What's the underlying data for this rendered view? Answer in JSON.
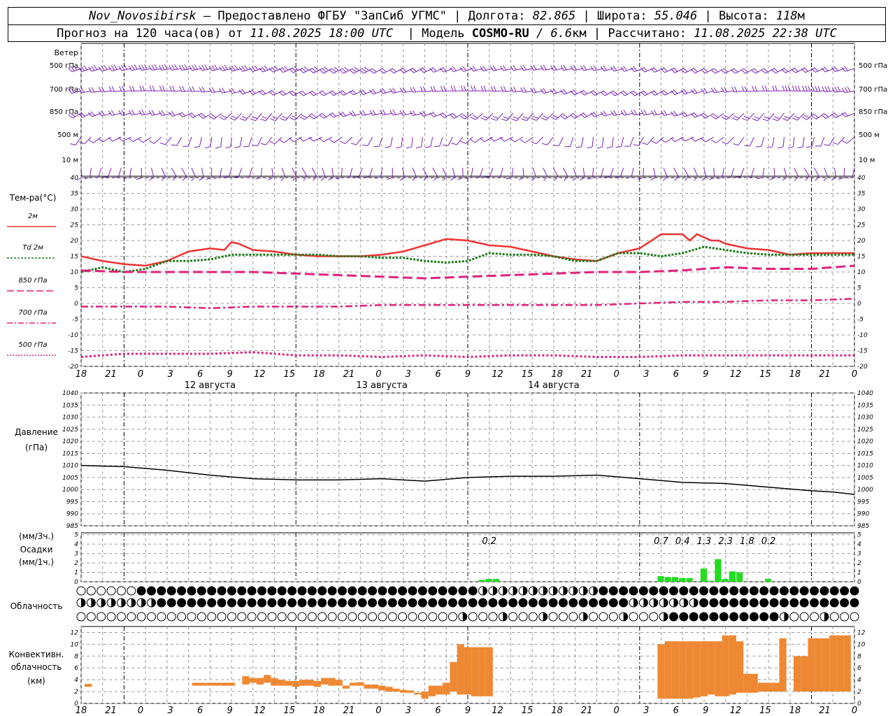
{
  "header": {
    "station": "Nov_Novosibirsk",
    "provider": "– Предоставлено ФГБУ \"ЗапСиб УГМС\"",
    "lon_label": "Долгота:",
    "lon_value": "82.865",
    "lat_label": "Широта:",
    "lat_value": "55.046",
    "alt_label": "Высота:",
    "alt_value": "118",
    "alt_unit": "м",
    "forecast_label": "Прогноз на 120 часа(ов) от",
    "forecast_from": "11.08.2025 18:00 UTC",
    "model_label": "Модель",
    "model_name": "COSMO-RU",
    "model_res_value": "/ 6.6",
    "model_res_unit": "км",
    "calc_label": "Рассчитано:",
    "calc_time": "11.08.2025 22:38 UTC"
  },
  "colors": {
    "temp2m": "#ee3333",
    "td2m": "#1a7a1a",
    "t850": "#e0207a",
    "t700": "#e0207a",
    "t500": "#e0207a",
    "wind": "#7a22b8",
    "pressure": "#000000",
    "precip": "#22dd22",
    "convective": "#ee8833",
    "grid": "#999999"
  },
  "time_axis": {
    "ticks": [
      "18",
      "21",
      "0",
      "3",
      "6",
      "9",
      "12",
      "15",
      "18",
      "21",
      "0",
      "3",
      "6",
      "9",
      "12",
      "15",
      "18",
      "21",
      "0",
      "3",
      "6",
      "9",
      "12",
      "15",
      "18",
      "21",
      "0"
    ],
    "days": [
      "12 августа",
      "13 августа",
      "14 августа"
    ]
  },
  "wind_panel": {
    "title": "Ветер",
    "levels": [
      "500 гПа",
      "700 гПа",
      "850 гПа",
      "500 м",
      "10 м"
    ]
  },
  "temp_panel": {
    "title": "Тем-ра(°C)",
    "legend": [
      {
        "label": "2м",
        "style": "solid"
      },
      {
        "label": "Td  2м",
        "style": "dotted"
      },
      {
        "label": "850 гПа",
        "style": "dash"
      },
      {
        "label": "700 гПа",
        "style": "dashdot"
      },
      {
        "label": "500 гПа",
        "style": "dot"
      }
    ],
    "ticks": [
      "40",
      "35",
      "30",
      "25",
      "20",
      "15",
      "10",
      "5",
      "0",
      "-5",
      "-10",
      "-15",
      "-20"
    ]
  },
  "pressure_panel": {
    "title": "Давление",
    "unit": "(гПа)",
    "ticks": [
      "1040",
      "1035",
      "1030",
      "1025",
      "1020",
      "1015",
      "1010",
      "1005",
      "1000",
      "995",
      "990",
      "985"
    ]
  },
  "precip_panel": {
    "unit3": "(мм/3ч.)",
    "title": "Осадки",
    "unit1": "(мм/1ч.)",
    "ticks": [
      "5",
      "4",
      "3",
      "2",
      "1",
      "0"
    ],
    "totals": [
      {
        "hour": 57,
        "text": "0.2"
      },
      {
        "hour": 81,
        "text": "0.7"
      },
      {
        "hour": 84,
        "text": "0.4"
      },
      {
        "hour": 87,
        "text": "1.3"
      },
      {
        "hour": 90,
        "text": "2.3"
      },
      {
        "hour": 93,
        "text": "1.8"
      },
      {
        "hour": 96,
        "text": "0.2"
      }
    ]
  },
  "cloud_panel": {
    "title": "Облачность"
  },
  "conv_panel": {
    "title1": "Конвективн.",
    "title2": "облачность",
    "unit": "(км)",
    "ticks": [
      "12",
      "10",
      "8",
      "6",
      "4",
      "2",
      "0"
    ]
  },
  "chart_data": [
    {
      "type": "line",
      "title": "Тем-ра(°C)",
      "x_unit": "hours since 11.08.2025 18:00 UTC",
      "ylim": [
        -20,
        40
      ],
      "series": [
        {
          "name": "2м",
          "x": [
            0,
            3,
            6,
            9,
            12,
            15,
            18,
            20,
            21,
            22,
            24,
            27,
            30,
            33,
            36,
            39,
            42,
            45,
            48,
            51,
            54,
            57,
            60,
            63,
            66,
            69,
            72,
            75,
            78,
            81,
            84,
            85,
            86,
            87,
            88,
            89,
            90,
            93,
            96,
            99,
            102,
            105,
            108
          ],
          "values": [
            15,
            13.5,
            12.5,
            12,
            13.5,
            16.5,
            17.5,
            17,
            19.5,
            19,
            17,
            16.5,
            15.5,
            15,
            15,
            15,
            15.5,
            16.5,
            18.5,
            20.5,
            20,
            18.5,
            18,
            16.5,
            15,
            14,
            13.5,
            16,
            17.5,
            22,
            22,
            20,
            22,
            21,
            20,
            20,
            19,
            17.5,
            17,
            15.5,
            16,
            16,
            16
          ]
        },
        {
          "name": "Td  2м",
          "x": [
            0,
            3,
            6,
            9,
            12,
            15,
            18,
            21,
            24,
            27,
            30,
            33,
            36,
            39,
            42,
            45,
            48,
            51,
            54,
            57,
            60,
            63,
            66,
            69,
            72,
            75,
            78,
            81,
            84,
            87,
            90,
            93,
            96,
            99,
            102,
            105,
            108
          ],
          "values": [
            10,
            11.5,
            10,
            11,
            13.5,
            13.5,
            14,
            15.5,
            15.5,
            15.5,
            15.5,
            15.5,
            15,
            15,
            14.5,
            14.5,
            13.5,
            13,
            13.5,
            16,
            15.5,
            15.5,
            15,
            13.5,
            13.5,
            16,
            16,
            15,
            16,
            18,
            17,
            16,
            15.5,
            15.5,
            15.5,
            15.5,
            15.5
          ]
        },
        {
          "name": "850 гПа",
          "x": [
            0,
            6,
            12,
            18,
            24,
            30,
            36,
            42,
            48,
            54,
            60,
            66,
            72,
            78,
            84,
            90,
            96,
            102,
            108
          ],
          "values": [
            10.5,
            10,
            10,
            10,
            10,
            9.5,
            9,
            8.5,
            8,
            8.5,
            9,
            9.5,
            10,
            10,
            10.5,
            11.5,
            11,
            11,
            12
          ]
        },
        {
          "name": "700 гПа",
          "x": [
            0,
            6,
            12,
            18,
            24,
            30,
            36,
            42,
            48,
            54,
            60,
            66,
            72,
            78,
            84,
            90,
            96,
            102,
            108
          ],
          "values": [
            -1,
            -1,
            -1,
            -1.5,
            -1,
            -1,
            -1,
            -0.5,
            -0.5,
            -0.5,
            -0.5,
            -0.5,
            -0.5,
            0,
            0.5,
            0.5,
            1,
            1,
            1.5
          ]
        },
        {
          "name": "500 гПа",
          "x": [
            0,
            6,
            12,
            18,
            24,
            30,
            36,
            42,
            48,
            54,
            60,
            66,
            72,
            78,
            84,
            90,
            96,
            102,
            108
          ],
          "values": [
            -17,
            -16,
            -16,
            -16,
            -15.5,
            -16.5,
            -16.5,
            -17,
            -16.5,
            -17,
            -16.5,
            -16.5,
            -17,
            -17,
            -16.5,
            -16.5,
            -16.5,
            -16.5,
            -16.5
          ]
        }
      ]
    },
    {
      "type": "line",
      "title": "Давление",
      "x_unit": "hours since 11.08.2025 18:00 UTC",
      "ylim": [
        985,
        1040
      ],
      "series": [
        {
          "name": "Давление",
          "x": [
            0,
            6,
            12,
            18,
            24,
            30,
            36,
            42,
            48,
            54,
            60,
            66,
            72,
            78,
            84,
            90,
            96,
            102,
            105,
            108
          ],
          "values": [
            1010,
            1009.5,
            1008,
            1006,
            1004.5,
            1004,
            1004,
            1004.5,
            1003.5,
            1005,
            1005.5,
            1005.5,
            1006,
            1004.5,
            1003,
            1002.5,
            1001,
            999.5,
            999,
            998
          ]
        }
      ]
    },
    {
      "type": "bar",
      "title": "Осадки",
      "x_unit": "hours since 11.08.2025 18:00 UTC",
      "ylim": [
        0,
        5
      ],
      "series": [
        {
          "name": "Осадки",
          "x": [
            56,
            57,
            58,
            81,
            82,
            83,
            84,
            85,
            87,
            88,
            89,
            90,
            91,
            92,
            96
          ],
          "values": [
            0.2,
            0.3,
            0.3,
            0.6,
            0.5,
            0.5,
            0.4,
            0.4,
            1.4,
            0.1,
            2.4,
            0.3,
            1.1,
            1.0,
            0.3
          ]
        }
      ]
    },
    {
      "type": "bar",
      "title": "Конвективн. облачность",
      "x_unit": "hours since 11.08.2025 18:00 UTC",
      "ylim": [
        0,
        13
      ],
      "series": [
        {
          "name": "Конвективн. облачность",
          "x": [
            1,
            16,
            17,
            18,
            19,
            20,
            21,
            23,
            24,
            25,
            26,
            27,
            28,
            29,
            30,
            31,
            32,
            33,
            34,
            35,
            36,
            37,
            38,
            39,
            40,
            41,
            42,
            43,
            44,
            45,
            46,
            47,
            48,
            49,
            50,
            51,
            52,
            53,
            54,
            55,
            56,
            57,
            81,
            82,
            83,
            84,
            85,
            86,
            87,
            88,
            89,
            90,
            91,
            92,
            93,
            94,
            95,
            96,
            97,
            98,
            100,
            101,
            102,
            103,
            104,
            105,
            106,
            107
          ],
          "base": [
            2.8,
            3,
            3,
            3,
            3,
            3,
            3,
            3.2,
            3.5,
            3.2,
            3.5,
            3,
            3,
            3,
            2.8,
            3,
            3,
            2.8,
            3.2,
            3,
            3,
            2.5,
            3,
            3,
            2.5,
            2.5,
            2.2,
            2,
            2,
            1.8,
            1.8,
            1.5,
            0.8,
            1.2,
            1.5,
            1.5,
            2,
            1.5,
            1.5,
            1.2,
            1.2,
            1.2,
            0.8,
            0.8,
            0.8,
            0.8,
            0.8,
            1,
            1.2,
            1.5,
            1.2,
            1.2,
            1.5,
            1.8,
            1.8,
            1.8,
            2,
            2,
            2,
            2,
            2,
            2,
            2,
            2,
            2,
            2,
            2,
            2
          ],
          "top": [
            3.3,
            3.5,
            3.5,
            3.5,
            3.5,
            3.5,
            3.5,
            4.6,
            4.3,
            4.3,
            4.8,
            4.3,
            4.0,
            3.8,
            3.8,
            4.0,
            4.0,
            3.8,
            4.3,
            4.3,
            4.0,
            3.0,
            3.5,
            3.6,
            3.2,
            3.2,
            3.0,
            2.8,
            2.5,
            2.3,
            2.2,
            1.8,
            2.0,
            3.0,
            3.0,
            3.5,
            7.0,
            10.0,
            9.5,
            9.5,
            9.5,
            9.5,
            10.0,
            10.5,
            10.5,
            10.5,
            10.5,
            10.5,
            10.5,
            10.5,
            10.5,
            11.5,
            11.5,
            10.5,
            5.0,
            5.0,
            3.5,
            3.5,
            3.5,
            11.0,
            8.0,
            8.0,
            11.0,
            11.0,
            11.0,
            11.5,
            11.5,
            11.5
          ]
        }
      ]
    }
  ]
}
